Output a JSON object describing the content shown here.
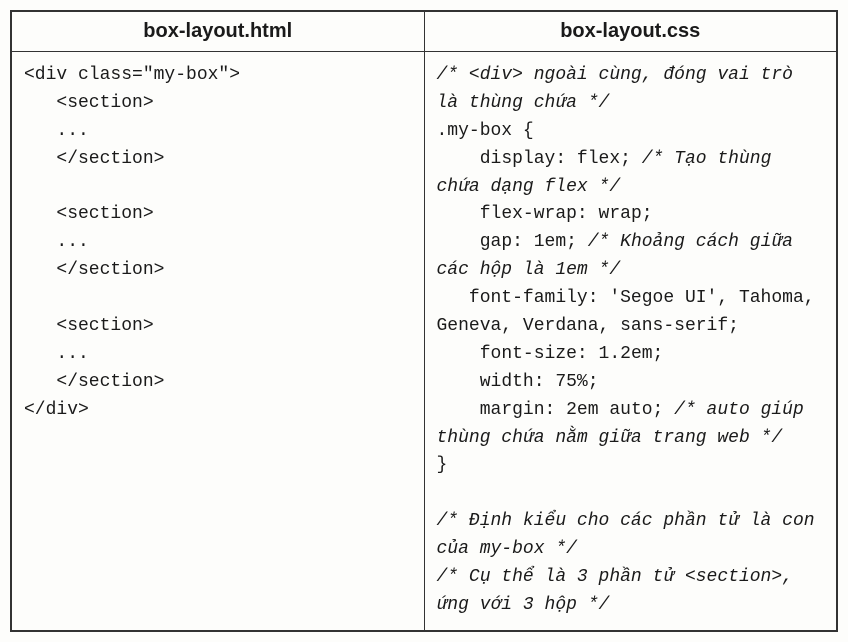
{
  "headers": {
    "left": "box-layout.html",
    "right": "box-layout.css"
  },
  "left_lines": [
    "<div class=\"my-box\">",
    "   <section>",
    "   ...",
    "   </section>",
    "",
    "   <section>",
    "   ...",
    "   </section>",
    "",
    "   <section>",
    "   ...",
    "   </section>",
    "</div>"
  ],
  "right_segments": [
    {
      "t": "/* <div> ngoài cùng, đóng vai trò là thùng chứa */",
      "c": true
    },
    {
      "t": "\n.my-box {",
      "c": false
    },
    {
      "t": "\n    display: flex; ",
      "c": false
    },
    {
      "t": "/* Tạo thùng chứa dạng flex */",
      "c": true
    },
    {
      "t": "\n    flex-wrap: wrap;",
      "c": false
    },
    {
      "t": "\n    gap: 1em; ",
      "c": false
    },
    {
      "t": "/* Khoảng cách giữa các hộp là 1em */",
      "c": true
    },
    {
      "t": "\n   font-family: 'Segoe UI', Tahoma, Geneva, Verdana, sans-serif;",
      "c": false
    },
    {
      "t": "\n    font-size: 1.2em;",
      "c": false
    },
    {
      "t": "\n    width: 75%;",
      "c": false
    },
    {
      "t": "\n    margin: 2em auto; ",
      "c": false
    },
    {
      "t": "/* auto giúp thùng chứa nằm giữa trang web */",
      "c": true
    },
    {
      "t": "\n}",
      "c": false
    },
    {
      "t": "\n\n",
      "c": false
    },
    {
      "t": "/* Định kiểu cho các phần tử là con của my-box */",
      "c": true
    },
    {
      "t": "\n",
      "c": false
    },
    {
      "t": "/* Cụ thể là 3 phần tử <section>, ứng với 3 hộp */",
      "c": true
    }
  ]
}
